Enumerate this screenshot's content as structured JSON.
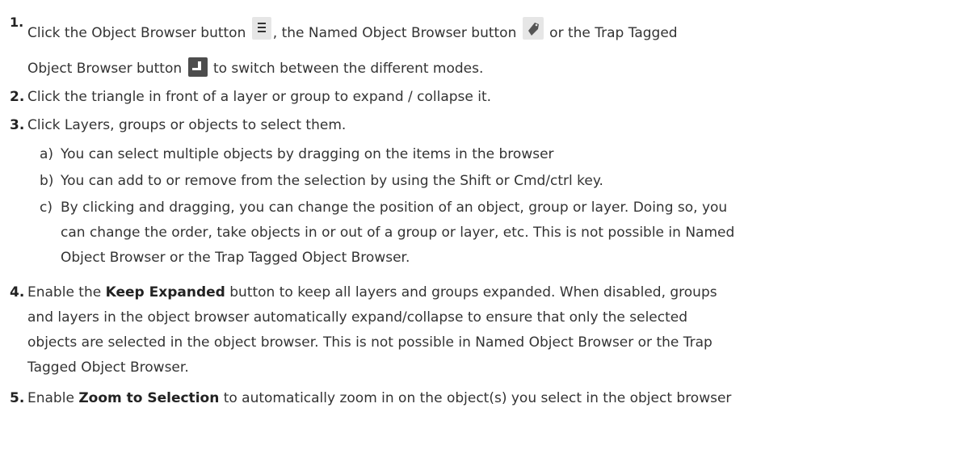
{
  "steps": [
    {
      "number": "1.",
      "line1_a": "Click the Object Browser button ",
      "line1_b": ", the Named Object Browser button ",
      "line1_c": " or the Trap Tagged",
      "line2_a": "Object Browser button ",
      "line2_b": " to switch between the different modes."
    },
    {
      "number": "2.",
      "text": "Click the triangle in front of a layer or group to expand / collapse it."
    },
    {
      "number": "3.",
      "text": "Click Layers, groups or objects to select them.",
      "subitems": [
        {
          "letter": "a)",
          "lines": [
            "You can select multiple objects by dragging on the items in the browser"
          ]
        },
        {
          "letter": "b)",
          "lines": [
            "You can add to or remove from the selection by using the Shift or Cmd/ctrl key."
          ]
        },
        {
          "letter": "c)",
          "lines": [
            "By clicking and dragging, you can change the position of an object, group or layer. Doing so, you",
            "can change the order, take objects in or out of a group or layer, etc. This is not possible in Named",
            "Object Browser or the Trap Tagged Object Browser."
          ]
        }
      ]
    },
    {
      "number": "4.",
      "pre": "Enable the ",
      "bold": "Keep Expanded",
      "post": " button to keep all layers and groups expanded. When disabled, groups",
      "lines": [
        "and layers in the object browser automatically expand/collapse to ensure that only the selected",
        "objects are selected in the object browser. This is not possible in Named Object Browser or the Trap",
        "Tagged Object Browser."
      ]
    },
    {
      "number": "5.",
      "pre": "Enable ",
      "bold": "Zoom to Selection",
      "post": " to automatically zoom in on the object(s) you select in the object browser"
    }
  ],
  "icons": {
    "object_browser": "list-icon",
    "named_object_browser": "tag-icon",
    "trap_tagged_browser": "trap-icon"
  }
}
